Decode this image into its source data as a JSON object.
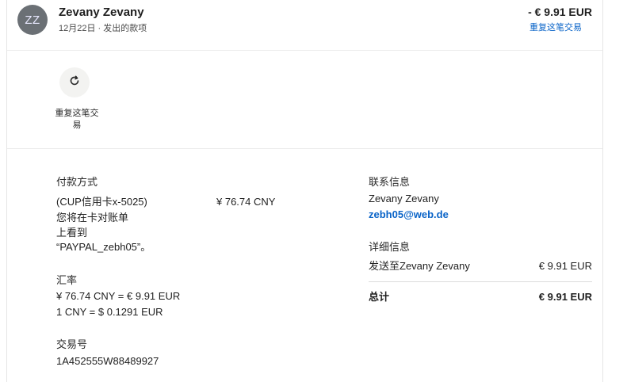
{
  "header": {
    "avatar_initials": "ZZ",
    "name": "Zevany Zevany",
    "subline": "12月22日 · 发出的款项",
    "amount": "- € 9.91 EUR",
    "repeat_link": "重复这笔交易"
  },
  "actions": {
    "repeat_label": "重复这笔交易",
    "repeat_icon": "refresh-icon"
  },
  "payment": {
    "title": "付款方式",
    "method_lines": [
      "(CUP信用卡x-5025)",
      "您将在卡对账单",
      "上看到",
      "“PAYPAL_zebh05”。"
    ],
    "amount": "¥ 76.74 CNY"
  },
  "exchange": {
    "title": "汇率",
    "line1": "¥ 76.74 CNY = € 9.91 EUR",
    "line2": "1 CNY = $ 0.1291 EUR"
  },
  "transaction": {
    "title": "交易号",
    "id": "1A452555W88489927"
  },
  "contact": {
    "title": "联系信息",
    "name": "Zevany Zevany",
    "email": "zebh05@web.de"
  },
  "details": {
    "title": "详细信息",
    "sent_label": "发送至Zevany Zevany",
    "sent_amount": "€ 9.91 EUR",
    "total_label": "总计",
    "total_amount": "€ 9.91 EUR"
  },
  "colors": {
    "link": "#0a64c8",
    "avatar_bg": "#6b7075"
  }
}
